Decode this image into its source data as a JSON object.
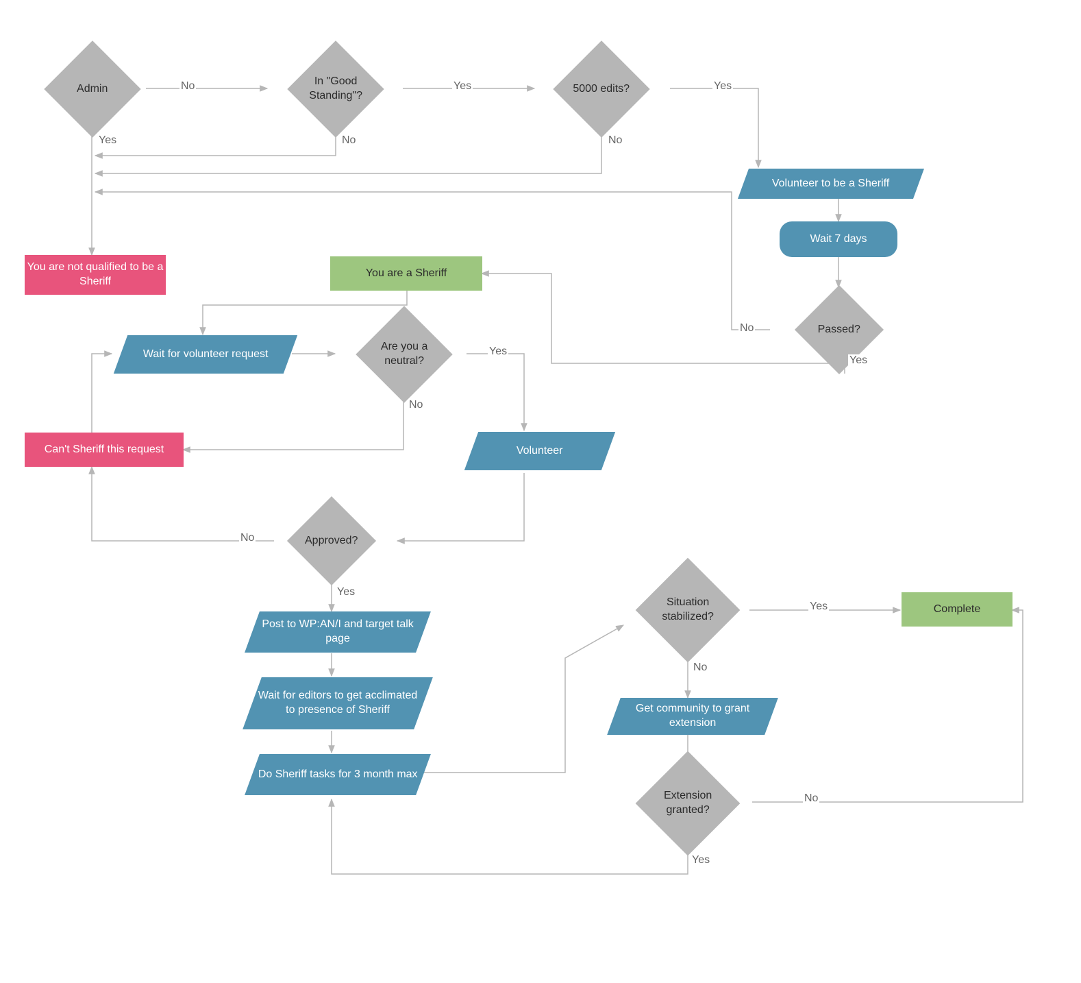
{
  "nodes": {
    "admin": "Admin",
    "good_standing": "In \"Good Standing\"?",
    "edits_5000": "5000 edits?",
    "not_qualified": "You are not qualified to be a Sheriff",
    "volunteer_sheriff": "Volunteer to be a Sheriff",
    "wait_7_days": "Wait 7 days",
    "passed": "Passed?",
    "you_are_sheriff": "You are a Sheriff",
    "wait_volunteer_req": "Wait for volunteer request",
    "are_you_neutral": "Are you a neutral?",
    "cant_sheriff": "Can't Sheriff this request",
    "volunteer": "Volunteer",
    "approved": "Approved?",
    "post_wpani": "Post to WP:AN/I and target talk page",
    "wait_acclimated": "Wait for editors to get acclimated to presence of Sheriff",
    "do_sheriff_tasks": "Do Sheriff tasks for 3 month max",
    "situation_stabilized": "Situation stabilized?",
    "complete": "Complete",
    "get_extension": "Get community to grant extension",
    "extension_granted": "Extension granted?"
  },
  "labels": {
    "yes": "Yes",
    "no": "No"
  }
}
